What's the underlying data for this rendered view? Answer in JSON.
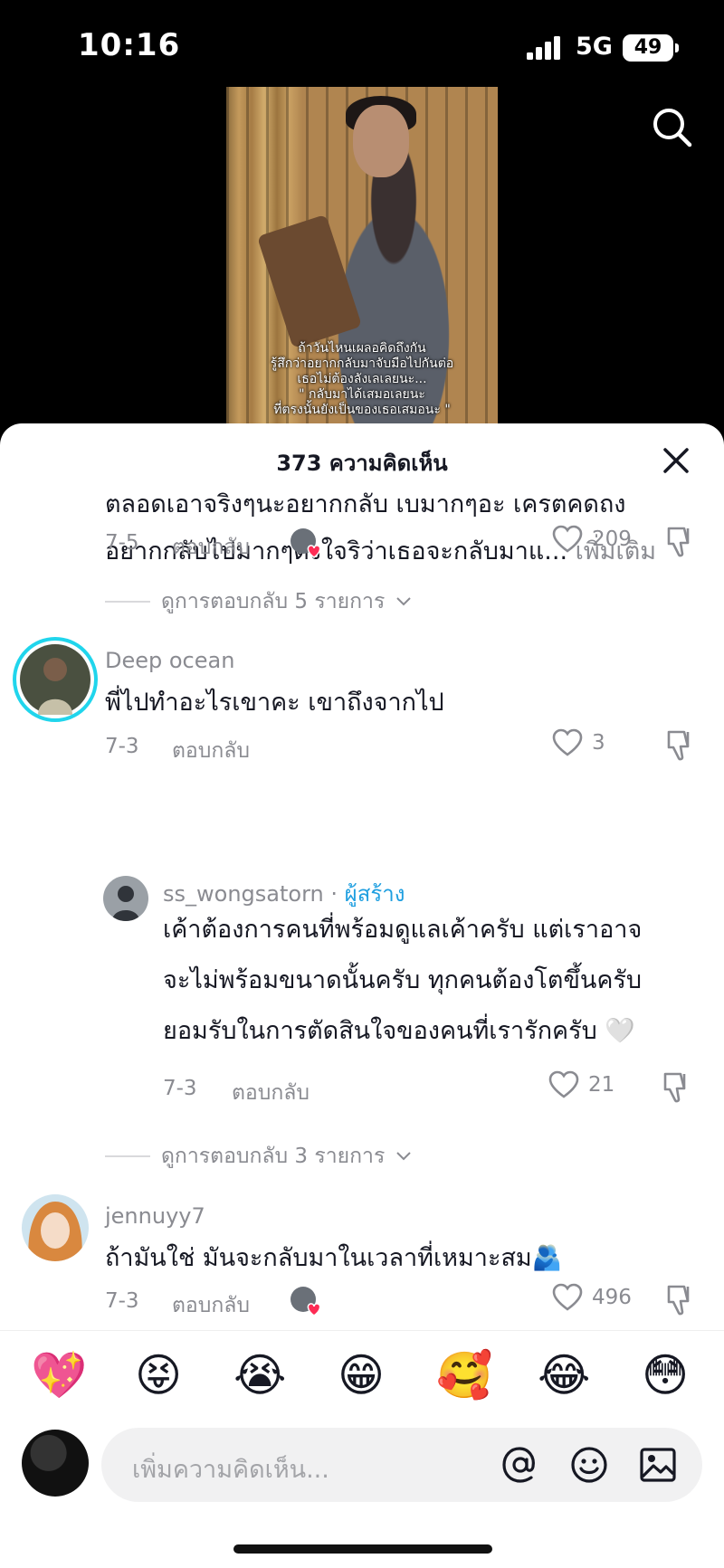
{
  "status_bar": {
    "time": "10:16",
    "network": "5G",
    "battery": "49"
  },
  "video": {
    "caption_lines": [
      "ถ้าวันไหนเผลอคิดถึงกัน",
      "รู้สึกว่าอยากกลับมาจับมือไปกันต่อ",
      "เธอไม่ต้องลังเลเลยนะ...",
      "\" กลับมาได้เสมอเลยนะ",
      "ที่ตรงนั้นยังเป็นของเธอเสมอนะ \""
    ]
  },
  "sheet": {
    "title": "373 ความคิดเห็น"
  },
  "comments": [
    {
      "text_line1": "ตลอดเอาจริงๆนะอยากกลับ เบมากๆอะ เครตคดถง",
      "text_line2": "อยากกลับไปมากๆตั้งใจริว่าเธอจะกลับมาแ...",
      "more": "เพิ่มเติม",
      "date": "7-5",
      "reply": "ตอบกลับ",
      "likes": "209",
      "view_replies": "ดูการตอบกลับ 5 รายการ"
    },
    {
      "username": "Deep ocean",
      "text": "พี่ไปทำอะไรเขาคะ เขาถึงจากไป",
      "date": "7-3",
      "reply": "ตอบกลับ",
      "likes": "3"
    },
    {
      "username": "ss_wongsatorn",
      "separator": "·",
      "badge": "ผู้สร้าง",
      "text_line1": "เค้าต้องการคนที่พร้อมดูแลเค้าครับ แต่เราอาจ",
      "text_line2": "จะไม่พร้อมขนาดนั้นครับ ทุกคนต้องโตขึ้นครับ",
      "text_line3": "ยอมรับในการตัดสินใจของคนที่เรารักครับ 🤍",
      "date": "7-3",
      "reply": "ตอบกลับ",
      "likes": "21",
      "view_replies": "ดูการตอบกลับ 3 รายการ"
    },
    {
      "username": "jennuyy7",
      "text": "ถ้ามันใช่ มันจะกลับมาในเวลาที่เหมาะสม🫂",
      "date": "7-3",
      "reply": "ตอบกลับ",
      "likes": "496"
    }
  ],
  "emoji_bar": [
    "💖",
    "😝",
    "😭",
    "😁",
    "🥰",
    "😂",
    "😳"
  ],
  "input": {
    "placeholder": "เพิ่มความคิดเห็น..."
  },
  "colors": {
    "accent": "#fe2c55",
    "creator": "#1f9fe0",
    "muted": "#8a8b91"
  }
}
